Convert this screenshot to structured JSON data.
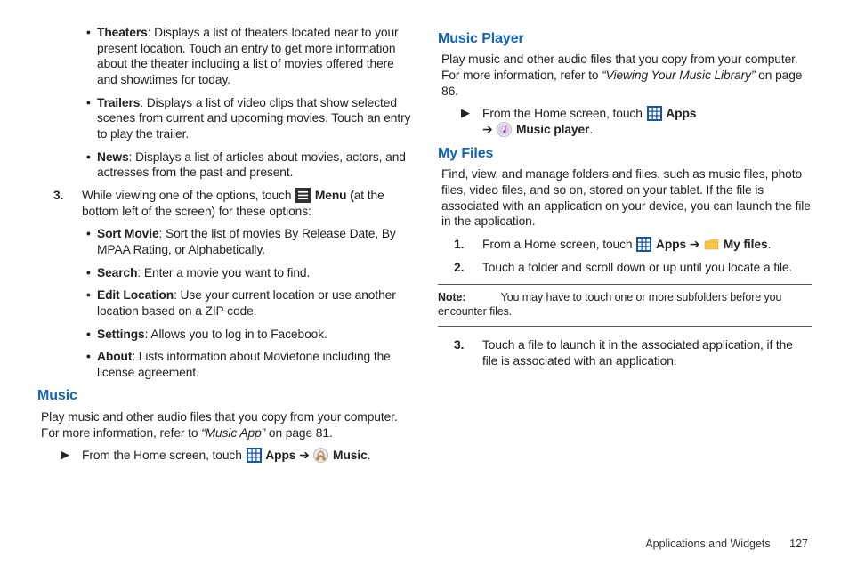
{
  "col1": {
    "bullets_top": [
      {
        "title": "Theaters",
        "desc": ": Displays a list of theaters located near to your present location. Touch an entry to get more information about the theater including a list of movies offered there and showtimes for today."
      },
      {
        "title": "Trailers",
        "desc": ": Displays a list of video clips that show selected scenes from current and upcoming movies. Touch an entry to play the trailer."
      },
      {
        "title": "News",
        "desc": ": Displays a list of articles about movies, actors, and actresses from the past and present."
      }
    ],
    "step3_pre": "While viewing one of the options, touch ",
    "step3_menu": "Menu (",
    "step3_post": "at the bottom left of the screen) for these options:",
    "bullets_menu": [
      {
        "title": "Sort Movie",
        "desc": ": Sort the list of movies By Release Date, By MPAA Rating, or Alphabetically."
      },
      {
        "title": "Search",
        "desc": ": Enter a movie you want to find."
      },
      {
        "title": "Edit Location",
        "desc": ": Use your current location or use another location based on a ZIP code."
      },
      {
        "title": "Settings",
        "desc": ": Allows you to log in to Facebook."
      },
      {
        "title": "About",
        "desc": ": Lists information about Moviefone including the license agreement."
      }
    ],
    "music_heading": "Music",
    "music_body_a": "Play music and other audio files that you copy from your computer. For more information, refer to ",
    "music_ref": "“Music App”",
    "music_body_b": "  on page 81.",
    "music_step_a": "From the Home screen, touch ",
    "music_apps": "Apps",
    "music_arrow": " ➔ ",
    "music_label": "Music",
    "period": "."
  },
  "col2": {
    "mp_heading": "Music Player",
    "mp_body_a": "Play music and other audio files that you copy from your computer. For more information, refer to ",
    "mp_ref": "“Viewing Your Music Library”",
    "mp_body_b": "  on page 86.",
    "mp_step_a": "From the Home screen, touch ",
    "mp_apps": "Apps",
    "mp_line2_arrow": "➔ ",
    "mp_label": "Music player",
    "mf_heading": "My Files",
    "mf_body": "Find, view, and manage folders and files, such as music files, photo files, video files, and so on, stored on your tablet. If the file is associated with an application on your device, you can launch the file in the application.",
    "mf_step1_a": "From a Home screen, touch ",
    "mf_apps": "Apps",
    "mf_arrow": " ➔ ",
    "mf_label": "My files",
    "mf_step2": "Touch a folder and scroll down or up until you locate a file.",
    "note_label": "Note:",
    "note_body": " You may have to touch one or more subfolders before you encounter files.",
    "mf_step3": "Touch a file to launch it in the associated application, if the file is associated with an application."
  },
  "footer": {
    "section": "Applications and Widgets",
    "page": "127"
  },
  "labels": {
    "num3": "3.",
    "num1": "1.",
    "num2": "2.",
    "tri": "▶"
  }
}
